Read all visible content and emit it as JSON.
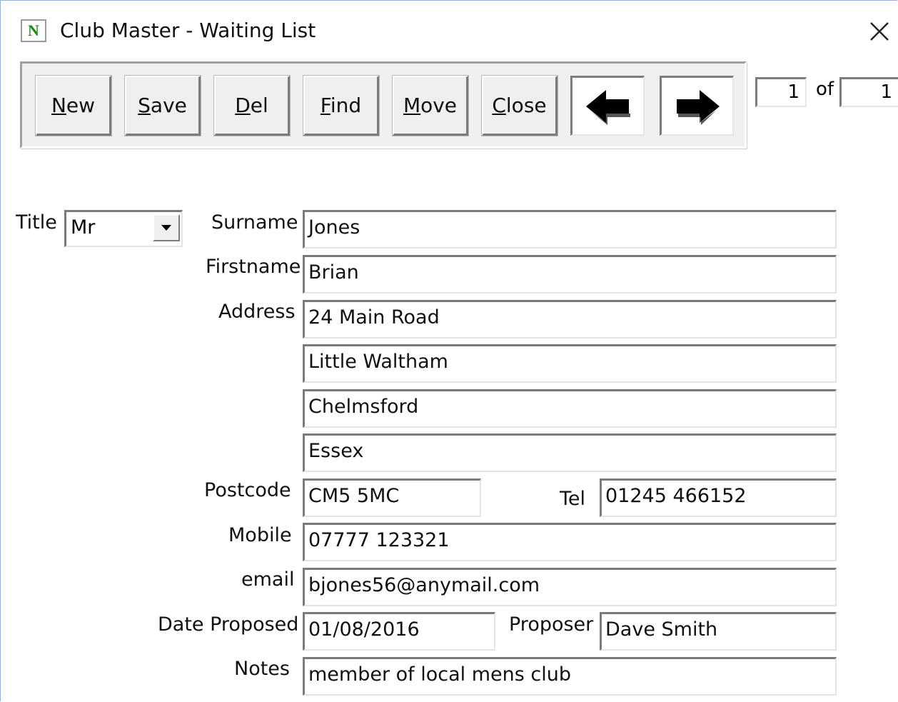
{
  "window": {
    "app_icon_letter": "N",
    "title": "Club Master - Waiting List",
    "close_icon": "close-icon"
  },
  "toolbar": {
    "buttons": [
      {
        "label": "New"
      },
      {
        "label": "Save"
      },
      {
        "label": "Del"
      },
      {
        "label": "Find"
      },
      {
        "label": "Move"
      },
      {
        "label": "Close"
      }
    ],
    "prev_icon": "arrow-left-icon",
    "next_icon": "arrow-right-icon"
  },
  "record": {
    "current": "1",
    "of_label": "of",
    "total": "1"
  },
  "form": {
    "title_label": "Title",
    "title_value": "Mr",
    "surname_label": "Surname",
    "surname": "Jones",
    "firstname_label": "Firstname",
    "firstname": "Brian",
    "address_label": "Address",
    "address": [
      "24 Main Road",
      "Little Waltham",
      "Chelmsford",
      "Essex"
    ],
    "postcode_label": "Postcode",
    "postcode": "CM5 5MC",
    "tel_label": "Tel",
    "tel": "01245 466152",
    "mobile_label": "Mobile",
    "mobile": "07777 123321",
    "email_label": "email",
    "email": "bjones56@anymail.com",
    "date_proposed_label": "Date Proposed",
    "date_proposed": "01/08/2016",
    "proposer_label": "Proposer",
    "proposer": "Dave Smith",
    "notes_label": "Notes",
    "notes": "member of local mens club"
  },
  "colors": {
    "icon_letter": "#1b8a1b",
    "window_border": "#8fb4d9",
    "face": "#f0f0f0"
  }
}
